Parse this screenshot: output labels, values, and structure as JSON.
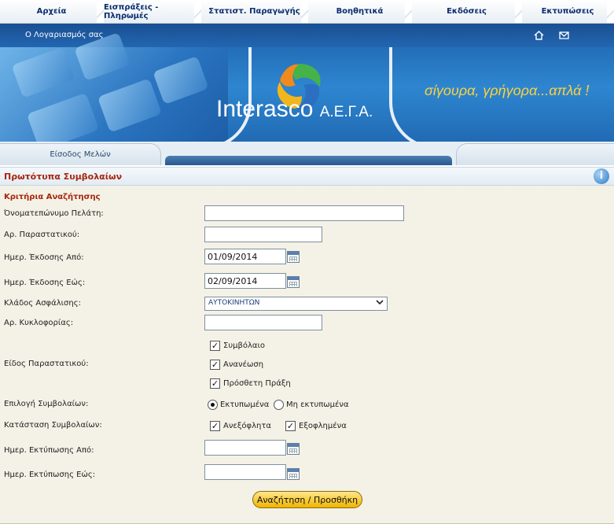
{
  "menu": {
    "items": [
      {
        "label": "Αρχεία"
      },
      {
        "label": "Εισπράξεις - Πληρωμές"
      },
      {
        "label": "Στατιστ. Παραγωγής"
      },
      {
        "label": "Βοηθητικά"
      },
      {
        "label": "Εκδόσεις"
      },
      {
        "label": "Εκτυπώσεις"
      }
    ]
  },
  "header": {
    "account_link": "Ο Λογαριασμός σας",
    "brand": "Interasco",
    "brand_suffix": "Α.Ε.Γ.Α.",
    "slogan": "σίγουρα, γρήγορα...απλά !",
    "members_tab": "Είσοδος Μελών"
  },
  "page": {
    "title": "Πρωτότυπα Συμβολαίων",
    "info_icon_glyph": "i"
  },
  "form": {
    "section_title": "Κριτήρια Αναζήτησης",
    "client_name_label": "Όνοματεπώνυμο Πελάτη:",
    "client_name_value": "",
    "doc_number_label": "Αρ. Παραστατικού:",
    "doc_number_value": "",
    "issue_from_label": "Ημερ. Έκδοσης Από:",
    "issue_from_value": "01/09/2014",
    "issue_to_label": "Ημερ. Έκδοσης Εώς:",
    "issue_to_value": "02/09/2014",
    "branch_label": "Κλάδος Ασφάλισης:",
    "branch_value": "ΑΥΤΟΚΙΝΗΤΩΝ",
    "plate_label": "Αρ. Κυκλοφορίας:",
    "plate_value": "",
    "doc_type_label": "Είδος Παραστατικού:",
    "doc_types": [
      {
        "label": "Συμβόλαιο",
        "checked": true
      },
      {
        "label": "Ανανέωση",
        "checked": true
      },
      {
        "label": "Πρόσθετη Πράξη",
        "checked": true
      }
    ],
    "selection_label": "Επιλογή Συμβολαίων:",
    "selection_options": [
      {
        "label": "Εκτυπωμένα",
        "selected": true
      },
      {
        "label": "Μη εκτυπωμένα",
        "selected": false
      }
    ],
    "status_label": "Κατάσταση Συμβολαίων:",
    "status_options": [
      {
        "label": "Ανεξόφλητα",
        "checked": true
      },
      {
        "label": "Εξοφλημένα",
        "checked": true
      }
    ],
    "print_from_label": "Ημερ. Εκτύπωσης Από:",
    "print_from_value": "",
    "print_to_label": "Ημερ. Εκτύπωσης Εώς:",
    "print_to_value": "",
    "search_button": "Αναζήτηση / Προσθήκη"
  }
}
